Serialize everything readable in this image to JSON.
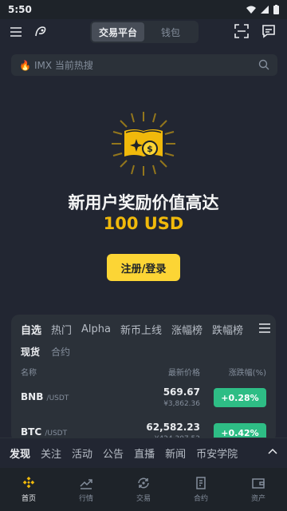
{
  "status": {
    "time": "5:50"
  },
  "header": {
    "tabs": [
      {
        "label": "交易平台"
      },
      {
        "label": "钱包"
      }
    ]
  },
  "search": {
    "placeholder": "IMX 当前热搜"
  },
  "hero": {
    "title": "新用户奖励价值高达",
    "amount": "100 USD",
    "button": "注册/登录"
  },
  "market": {
    "tabs": [
      "自选",
      "热门",
      "Alpha",
      "新币上线",
      "涨幅榜",
      "跌幅榜"
    ],
    "subtabs": [
      "现货",
      "合约"
    ],
    "columns": {
      "name": "名称",
      "price": "最新价格",
      "change": "涨跌幅(%)"
    },
    "rows": [
      {
        "symbol": "BNB",
        "quote": "/USDT",
        "price": "569.67",
        "fiat": "¥3,862.36",
        "change": "+0.28%"
      },
      {
        "symbol": "BTC",
        "quote": "/USDT",
        "price": "62,582.23",
        "fiat": "¥424,307.52",
        "change": "+0.42%"
      }
    ]
  },
  "discover": {
    "tabs": [
      "发现",
      "关注",
      "活动",
      "公告",
      "直播",
      "新闻",
      "币安学院"
    ]
  },
  "nav": {
    "items": [
      {
        "label": "首页"
      },
      {
        "label": "行情"
      },
      {
        "label": "交易"
      },
      {
        "label": "合约"
      },
      {
        "label": "资产"
      }
    ]
  },
  "colors": {
    "accent": "#FCD535",
    "gain": "#2EBD85",
    "background": "#222632"
  }
}
